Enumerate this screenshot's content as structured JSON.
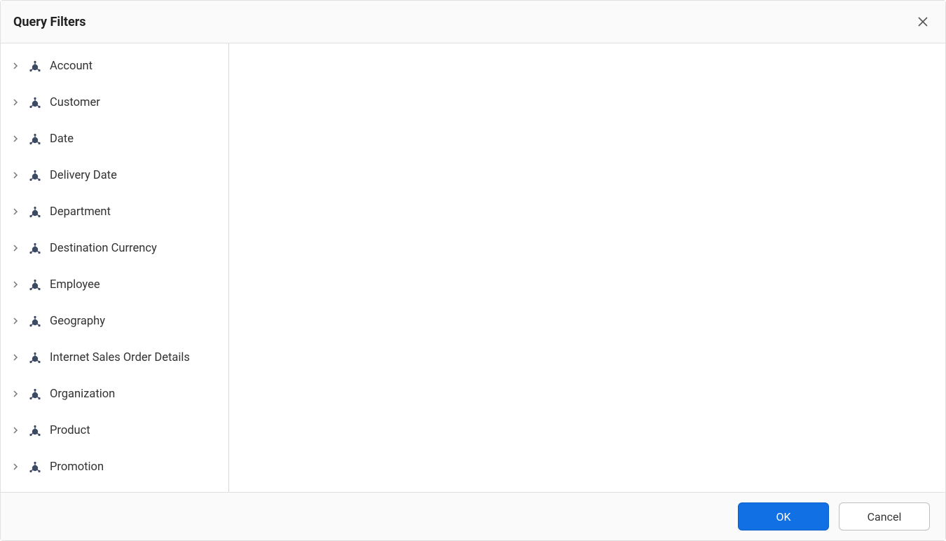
{
  "header": {
    "title": "Query Filters"
  },
  "sidebar": {
    "items": [
      {
        "label": "Account"
      },
      {
        "label": "Customer"
      },
      {
        "label": "Date"
      },
      {
        "label": "Delivery Date"
      },
      {
        "label": "Department"
      },
      {
        "label": "Destination Currency"
      },
      {
        "label": "Employee"
      },
      {
        "label": "Geography"
      },
      {
        "label": "Internet Sales Order Details"
      },
      {
        "label": "Organization"
      },
      {
        "label": "Product"
      },
      {
        "label": "Promotion"
      }
    ]
  },
  "footer": {
    "ok_label": "OK",
    "cancel_label": "Cancel"
  }
}
